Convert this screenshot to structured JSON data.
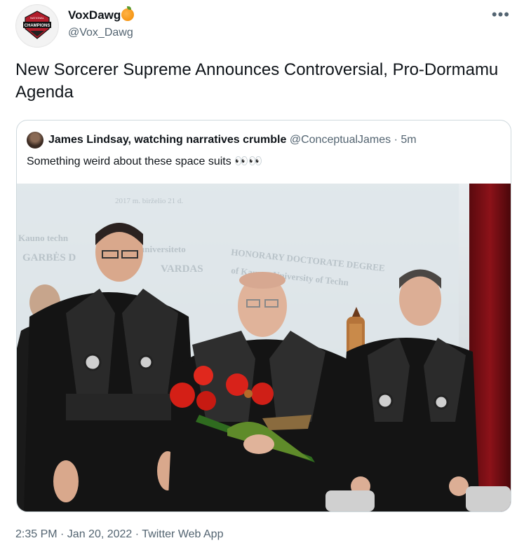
{
  "tweet": {
    "display_name": "VoxDawg",
    "handle": "@Vox_Dawg",
    "text": "New Sorcerer Supreme Announces Controversial, Pro-Dormamu Agenda",
    "more_label": "•••",
    "timestamp": "2:35 PM · Jan 20, 2022 · Twitter Web App"
  },
  "avatar": {
    "line1": "NATIONAL",
    "line2": "CHAMPIONS"
  },
  "quote": {
    "author_name": "James Lindsay, watching narratives crumble",
    "author_handle": "@ConceptualJames",
    "time": "5m",
    "separator": "·",
    "text": "Something weird about these space suits 👀👀"
  },
  "photo": {
    "screen_lines": [
      "2017 m. birželio 21 d.",
      "Kauno techn",
      "universiteto",
      "GARBĖS D",
      "VARDAS",
      "HONORARY DOCTORATE DEGREE",
      "of Kaunas University of Techn"
    ]
  }
}
